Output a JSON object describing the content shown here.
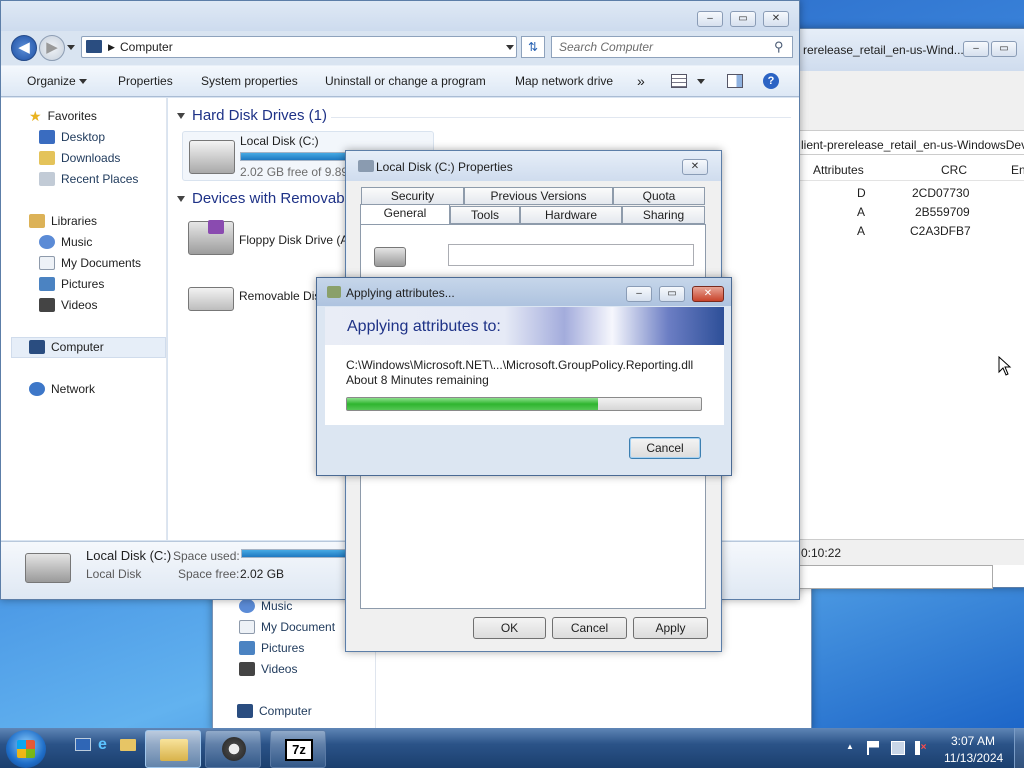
{
  "explorer": {
    "address": "Computer",
    "search_placeholder": "Search Computer",
    "toolbar": [
      "Organize",
      "Properties",
      "System properties",
      "Uninstall or change a program",
      "Map network drive"
    ],
    "toolbar_more": "»",
    "nav": {
      "favorites": "Favorites",
      "desktop": "Desktop",
      "downloads": "Downloads",
      "recent": "Recent Places",
      "libraries": "Libraries",
      "music": "Music",
      "documents": "My Documents",
      "pictures": "Pictures",
      "videos": "Videos",
      "computer": "Computer",
      "network": "Network"
    },
    "group_hdd": "Hard Disk Drives (1)",
    "group_removable": "Devices with Removable",
    "local_disk_name": "Local Disk (C:)",
    "local_disk_free": "2.02 GB free of 9.89 G",
    "local_disk_used_fraction": 0.8,
    "floppy_name": "Floppy Disk Drive (A",
    "removable_name": "Removable Dis",
    "details": {
      "name": "Local Disk (C:)",
      "type": "Local Disk",
      "space_used_label": "Space used:",
      "space_free_label": "Space free:",
      "space_free": "2.02 GB"
    }
  },
  "bg_explorer": {
    "music": "Music",
    "documents": "My Document",
    "pictures": "Pictures",
    "videos": "Videos",
    "computer": "Computer"
  },
  "zip_window": {
    "title": "rerelease_retail_en-us-Wind...",
    "path": "lient-prerelease_retail_en-us-WindowsDev",
    "columns": [
      "Attributes",
      "CRC",
      "En"
    ],
    "rows": [
      {
        "attr": "D",
        "crc": "2CD07730"
      },
      {
        "attr": "A",
        "crc": "2B559709"
      },
      {
        "attr": "A",
        "crc": "C2A3DFB7"
      }
    ],
    "status_time": "0:10:22"
  },
  "props": {
    "title": "Local Disk (C:) Properties",
    "tabs_row1": [
      "Security",
      "Previous Versions",
      "Quota"
    ],
    "tabs_row2": [
      "General",
      "Tools",
      "Hardware",
      "Sharing"
    ],
    "ok": "OK",
    "cancel": "Cancel",
    "apply": "Apply"
  },
  "progress": {
    "title": "Applying attributes...",
    "heading": "Applying attributes to:",
    "file": "C:\\Windows\\Microsoft.NET\\...\\Microsoft.GroupPolicy.Reporting.dll",
    "remaining": "About 8 Minutes remaining",
    "fraction": 0.71,
    "cancel": "Cancel"
  },
  "taskbar": {
    "time": "3:07 AM",
    "date": "11/13/2024",
    "seven_zip_label": "7z",
    "tray_up": "▲"
  },
  "colors": {
    "accent": "#1e3287",
    "progress": "#3cbe3c",
    "taskbar": "#1b3f6e"
  }
}
